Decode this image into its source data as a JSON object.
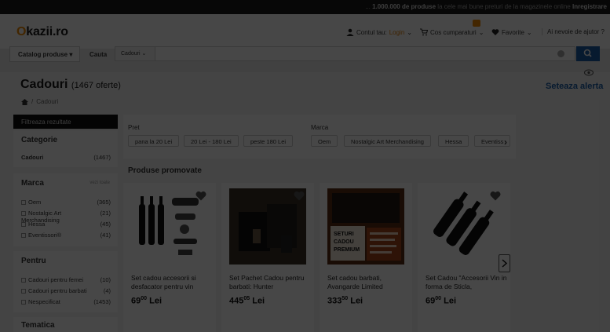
{
  "topbar": {
    "message_prefix": "...",
    "message_highlight": "1.000.000 de produse",
    "message_rest": "la cele mai bune preturi de la magazinele online",
    "link": "Inregistrare"
  },
  "header": {
    "logo_main": "kazii.ro",
    "logo_o": "O",
    "account_label": "Contul tau:",
    "login_label": "Login",
    "cart_label": "Cos cumparaturi",
    "favorites_label": "Favorite",
    "help_label": "Ai nevoie de ajutor ?"
  },
  "search": {
    "catalog_label": "Catalog produse",
    "cauta_label": "Cauta",
    "category_value": "Cadouri",
    "placeholder": ""
  },
  "page": {
    "title": "Cadouri",
    "offers": "(1467 oferte)",
    "alert_link": "Seteaza alerta",
    "breadcrumb_current": "Cadouri"
  },
  "filters": {
    "header": "Filtreaza rezultate",
    "categorie": {
      "title": "Categorie",
      "items": [
        {
          "label": "Cadouri",
          "count": "(1467)"
        }
      ]
    },
    "marca": {
      "title": "Marca",
      "see_all": "vezi toate",
      "items": [
        {
          "label": "Oem",
          "count": "(365)"
        },
        {
          "label": "Nostalgic Art Merchandising",
          "count": "(21)"
        },
        {
          "label": "Hessa",
          "count": "(45)"
        },
        {
          "label": "Eventissori®",
          "count": "(41)"
        }
      ]
    },
    "pentru": {
      "title": "Pentru",
      "items": [
        {
          "label": "Cadouri pentru femei",
          "count": "(10)"
        },
        {
          "label": "Cadouri pentru barbati",
          "count": "(4)"
        },
        {
          "label": "Nespecificat",
          "count": "(1453)"
        }
      ]
    },
    "tematica": {
      "title": "Tematica"
    }
  },
  "top_filters": {
    "pret_title": "Pret",
    "pret_chips": [
      "pana la 20 Lei",
      "20 Lei - 180 Lei",
      "peste 180 Lei"
    ],
    "marca_title": "Marca",
    "marca_chips": [
      "Oem",
      "Nostalgic Art Merchandising",
      "Hessa",
      "Eventiss"
    ]
  },
  "promo": {
    "title": "Produse promovate",
    "products": [
      {
        "title": "Set cadou accesorii si desfacator pentru vin",
        "price_int": "69",
        "price_dec": "00",
        "currency": "Lei"
      },
      {
        "title": "Set Pachet Cadou pentru barbati: Hunter",
        "price_int": "445",
        "price_dec": "05",
        "currency": "Lei"
      },
      {
        "title": "Set cadou barbati, Avangarde Limited",
        "price_int": "333",
        "price_dec": "50",
        "currency": "Lei",
        "image_text": [
          "SETURI",
          "CADOU",
          "PREMIUM"
        ]
      },
      {
        "title": "Set Cadou \"Accesorii Vin in forma de Sticla,",
        "price_int": "69",
        "price_dec": "00",
        "currency": "Lei"
      }
    ]
  },
  "colors": {
    "accent": "#f08a00",
    "link": "#1a5ea8",
    "overlay": "rgba(0,0,0,0.72)"
  }
}
